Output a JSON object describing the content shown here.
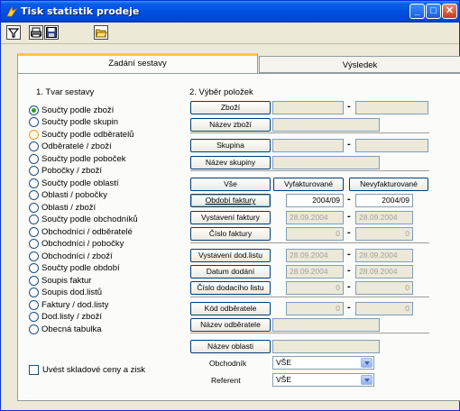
{
  "window": {
    "title": "Tisk statistik prodeje",
    "controls": {
      "minimize": "_",
      "maximize": "□",
      "close": "✕"
    }
  },
  "toolbar": {
    "items": [
      "filter-icon",
      "print-icon",
      "save-icon",
      "open-icon"
    ]
  },
  "tabs": {
    "active": "Zadání sestavy",
    "inactive": "Výsledek"
  },
  "section1": {
    "label": "1. Tvar sestavy",
    "options": [
      "Součty podle zboží",
      "Součty podle skupin",
      "Součty podle odběratelů",
      "Odběratelé / zboží",
      "Součty podle poboček",
      "Pobočky / zboží",
      "Součty podle oblastí",
      "Oblasti / pobočky",
      "Oblasti / zboží",
      "Součty podle obchodníků",
      "Obchodníci / odběratelé",
      "Obchodníci / pobočky",
      "Obchodníci / zboží",
      "Součty podle období",
      "Soupis faktur",
      "Soupis dod.listů",
      "Faktury / dod.listy",
      "Dod.listy / zboží",
      "Obecná tabulka"
    ],
    "selected": "Součty podle zboží",
    "checkbox": "Uvést skladové ceny a zisk"
  },
  "section2": {
    "label": "2. Výběr položek",
    "zbozi": "Zboží",
    "nazev_zbozi": "Název zboží",
    "skupina": "Skupina",
    "nazev_skupiny": "Název skupiny",
    "vse": "Vše",
    "vyfakturovane": "Vyfakturované",
    "nevyfakturovane": "Nevyfakturované",
    "obdobi_faktury": "Období faktury",
    "obdobi_od": "2004/09",
    "obdobi_do": "2004/09",
    "vystaveni_faktury": "Vystavení faktury",
    "vystaveni_od": "28.09.2004",
    "vystaveni_do": "28.09.2004",
    "cislo_faktury": "Číslo faktury",
    "cislo_od": "0",
    "cislo_do": "0",
    "vystaveni_dodlistu": "Vystavení dod.listu",
    "vystaveni_dod_od": "28.09.2004",
    "vystaveni_dod_do": "28.09.2004",
    "datum_dodani": "Datum dodání",
    "datum_od": "28.09.2004",
    "datum_do": "28.09.2004",
    "cislo_dodaciho_listu": "Číslo dodacího listu",
    "cislo_dl_od": "0",
    "cislo_dl_do": "0",
    "kod_odberatele": "Kód odběratele",
    "kod_od": "0",
    "kod_do": "0",
    "nazev_odberatele": "Název odběratele",
    "nazev_oblasti": "Název oblasti",
    "obchodnik_label": "Obchodník",
    "obchodnik_value": "VŠE",
    "referent_label": "Referent",
    "referent_value": "VŠE",
    "dash": "-"
  }
}
